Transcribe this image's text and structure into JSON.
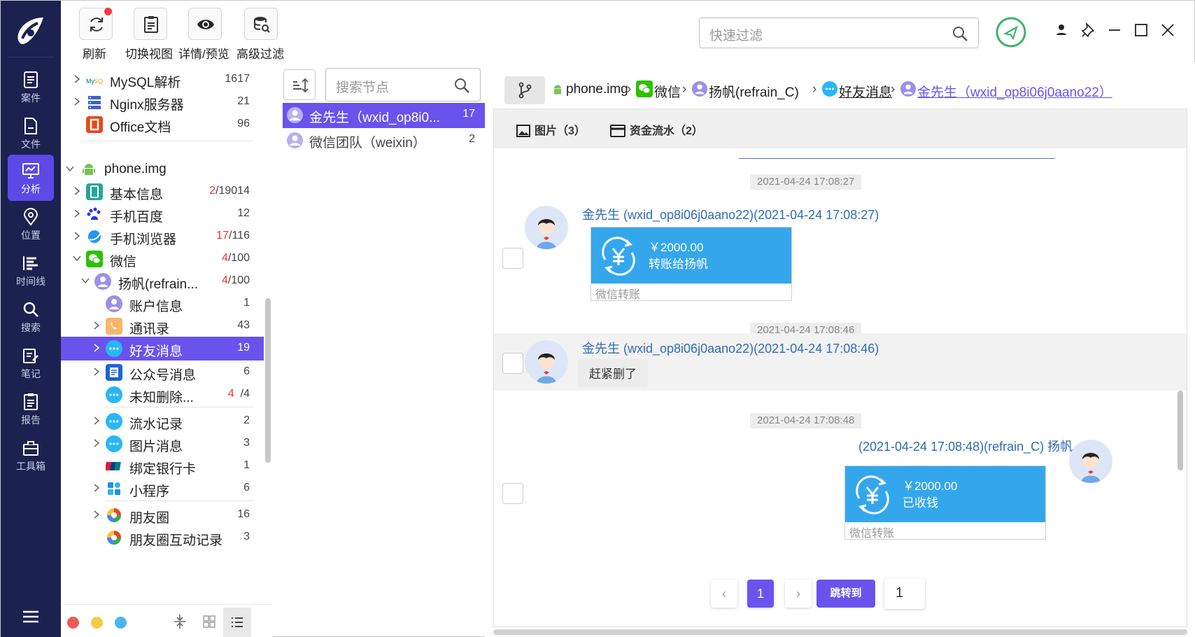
{
  "toolbar": {
    "buttons": [
      {
        "label": "刷新",
        "icon": "refresh-icon"
      },
      {
        "label": "切换视图",
        "icon": "clipboard-icon"
      },
      {
        "label": "详情/预览",
        "icon": "eye-icon"
      },
      {
        "label": "高级过滤",
        "icon": "database-search-icon"
      }
    ],
    "quick_filter_placeholder": "快速过滤"
  },
  "rail": {
    "items": [
      {
        "label": "案件",
        "icon": "case-icon"
      },
      {
        "label": "文件",
        "icon": "file-icon"
      },
      {
        "label": "分析",
        "icon": "analysis-icon",
        "active": true
      },
      {
        "label": "位置",
        "icon": "location-icon"
      },
      {
        "label": "时间线",
        "icon": "timeline-icon"
      },
      {
        "label": "搜索",
        "icon": "search-icon"
      },
      {
        "label": "笔记",
        "icon": "note-icon"
      },
      {
        "label": "报告",
        "icon": "report-icon"
      },
      {
        "label": "工具箱",
        "icon": "toolbox-icon"
      }
    ]
  },
  "tree": {
    "items": [
      {
        "label": "MySQL解析",
        "count": "1617"
      },
      {
        "label": "Nginx服务器",
        "count": "21"
      },
      {
        "label": "Office文档",
        "count": "96"
      },
      {
        "label": "phone.img",
        "count": ""
      },
      {
        "label": "基本信息",
        "count_red": "2",
        "count": "/19014"
      },
      {
        "label": "手机百度",
        "count": "12"
      },
      {
        "label": "手机浏览器",
        "count_red": "17",
        "count": "/116"
      },
      {
        "label": "微信",
        "count_red": "4",
        "count": "/100"
      },
      {
        "label": "扬帆(refrain...",
        "count_red": "4",
        "count": "/100"
      },
      {
        "label": "账户信息",
        "count": "1"
      },
      {
        "label": "通讯录",
        "count": "43"
      },
      {
        "label": "好友消息",
        "count": "19"
      },
      {
        "label": "公众号消息",
        "count": "6"
      },
      {
        "label": "未知删除...",
        "count_red": "4",
        "count": "/4"
      },
      {
        "label": "流水记录",
        "count": "2"
      },
      {
        "label": "图片消息",
        "count": "3"
      },
      {
        "label": "绑定银行卡",
        "count": "1"
      },
      {
        "label": "小程序",
        "count": "6"
      },
      {
        "label": "朋友圈",
        "count": "16"
      },
      {
        "label": "朋友圈互动记录",
        "count": "3"
      }
    ]
  },
  "middle": {
    "search_placeholder": "搜索节点",
    "contacts": [
      {
        "name": "金先生（wxid_op8i0...",
        "count": "17"
      },
      {
        "name": "微信团队（weixin）",
        "count": "2"
      }
    ]
  },
  "breadcrumb": {
    "items": [
      "phone.img",
      "微信",
      "扬帆(refrain_C)",
      "好友消息",
      "金先生（wxid_op8i06j0aano22）"
    ],
    "separator": "›"
  },
  "tabs": [
    {
      "label": "图片（3）",
      "icon": "image-icon"
    },
    {
      "label": "资金流水（2）",
      "icon": "card-icon"
    }
  ],
  "messages": [
    {
      "time": "2021-04-24 17:08:27",
      "sender": "金先生 (wxid_op8i06j0aano22)(2021-04-24 17:08:27)",
      "amount": "￥2000.00",
      "desc": "转账给扬帆",
      "footer": "微信转账"
    },
    {
      "time": "2021-04-24 17:08:46",
      "sender": "金先生 (wxid_op8i06j0aano22)(2021-04-24 17:08:46)",
      "text": "赶紧删了"
    },
    {
      "time": "2021-04-24 17:08:48",
      "sender": "(2021-04-24 17:08:48)(refrain_C) 扬帆",
      "amount": "￥2000.00",
      "desc": "已收钱",
      "footer": "微信转账"
    }
  ],
  "pagination": {
    "prev": "‹",
    "current": "1",
    "next": "›",
    "jump_label": "跳转到",
    "jump_value": "1"
  },
  "colors": {
    "accent": "#6a53ec",
    "rail_bg": "#1b2250",
    "transfer_blue": "#34a7ec",
    "sender_blue": "#2f6db5",
    "count_red": "#e33333"
  }
}
